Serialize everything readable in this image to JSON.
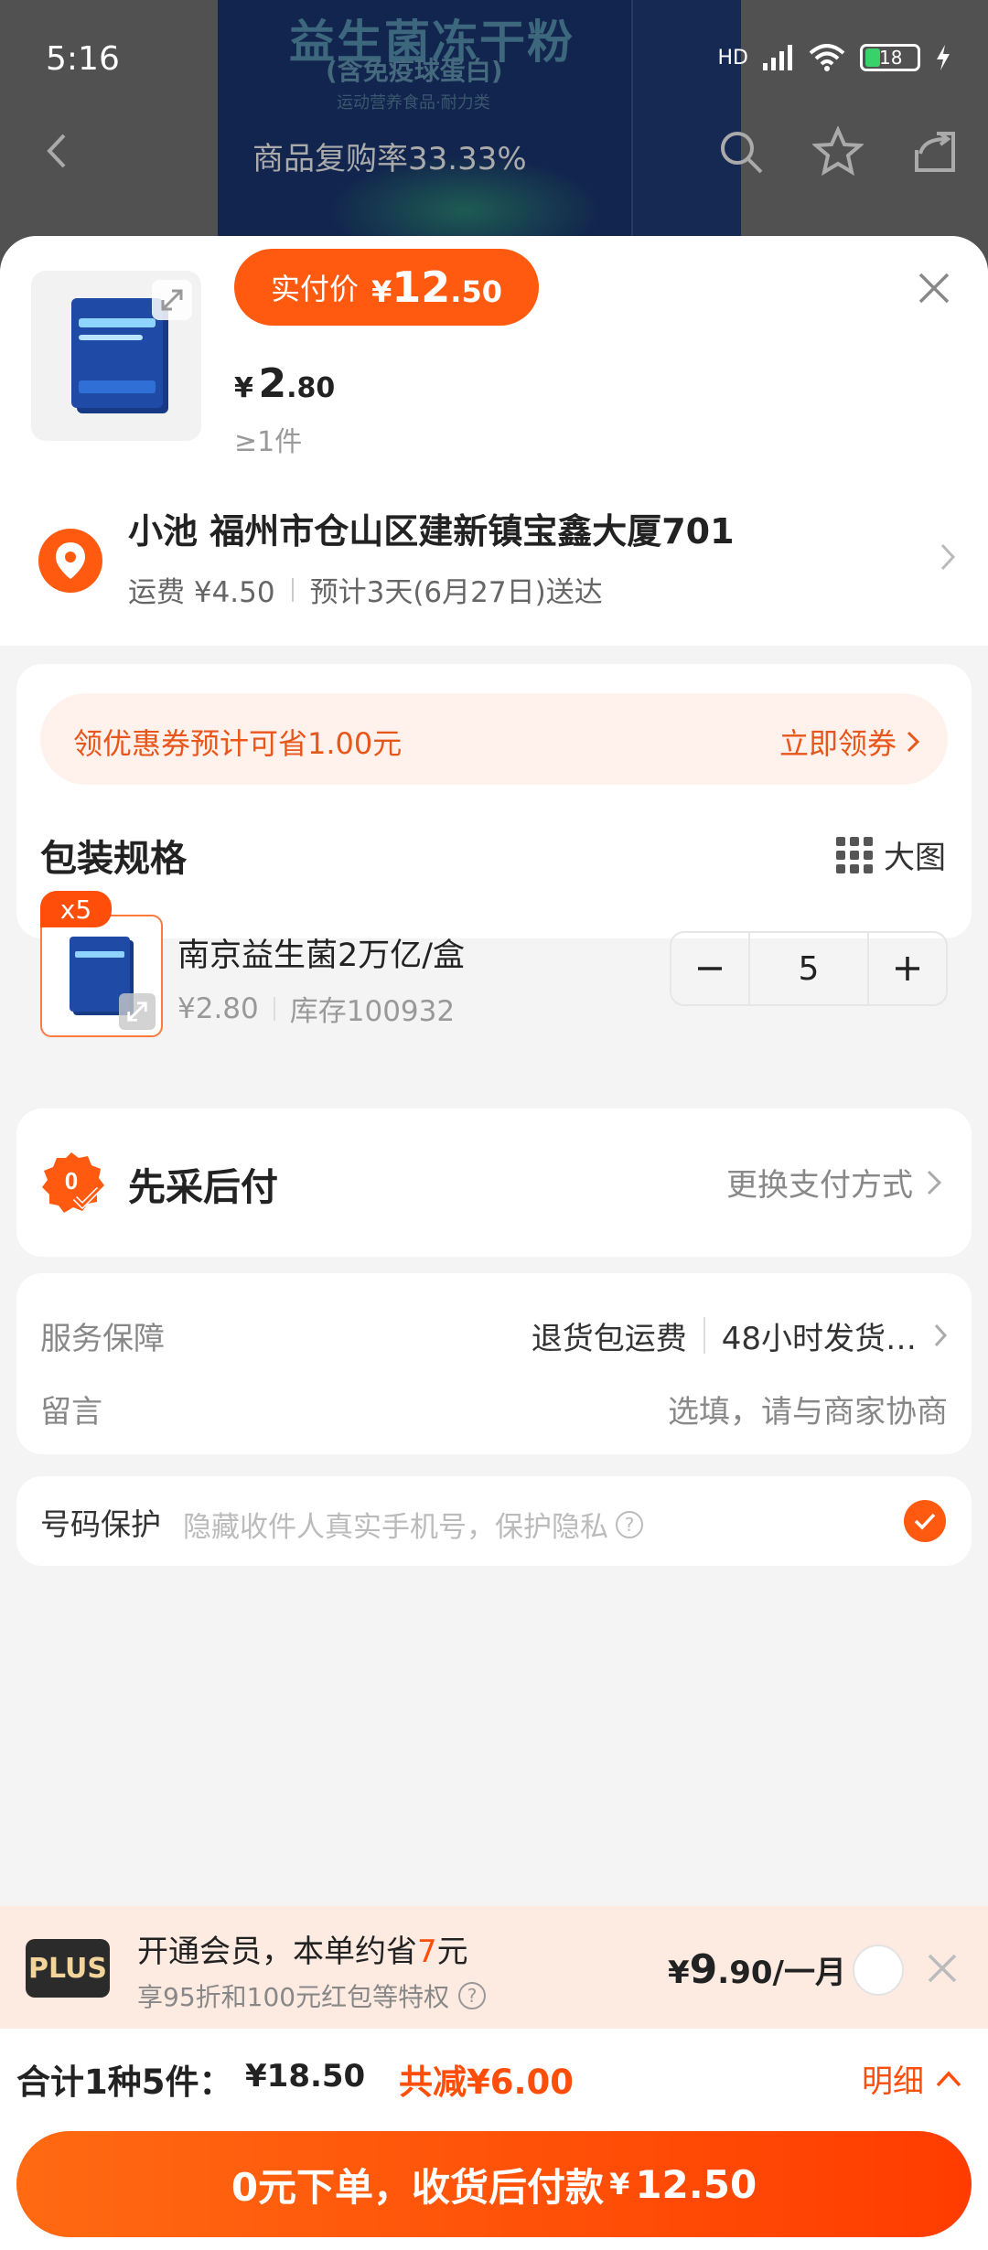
{
  "status_bar": {
    "time": "5:16",
    "battery": "18",
    "network": "HD"
  },
  "background_page": {
    "product_title": "益生菌冻干粉",
    "product_subtitle": "(含免疫球蛋白)",
    "product_caption": "运动营养食品·耐力类",
    "nav_title": "商品复购率33.33%"
  },
  "header": {
    "pay_label": "实付价",
    "pay_currency": "¥",
    "pay_int": "12",
    "pay_dec": ".50",
    "unit_currency": "¥",
    "unit_int": "2",
    "unit_dec": ".80",
    "min_qty": "≥1件"
  },
  "address": {
    "line": "小池 福州市仓山区建新镇宝鑫大厦701",
    "shipping": "运费 ¥4.50",
    "eta": "预计3天(6月27日)送达"
  },
  "coupon": {
    "text": "领优惠券预计可省1.00元",
    "link": "立即领券"
  },
  "package": {
    "title": "包装规格",
    "big_view": "大图",
    "sku": {
      "badge": "x5",
      "name": "南京益生菌2万亿/盒",
      "price": "¥2.80",
      "stock": "库存100932",
      "quantity": "5"
    }
  },
  "payment": {
    "title": "先采后付",
    "change": "更换支付方式"
  },
  "services": {
    "label": "服务保障",
    "items": [
      "退货包运费",
      "48小时发货…"
    ],
    "message_label": "留言",
    "message_placeholder": "选填，请与商家协商"
  },
  "privacy": {
    "label": "号码保护",
    "hint": "隐藏收件人真实手机号，保护隐私",
    "checked": true
  },
  "plus": {
    "logo": "PLUS",
    "title_pre": "开通会员，本单约省",
    "title_hl": "7",
    "title_post": "元",
    "subtitle": "享95折和100元红包等特权",
    "price_currency": "¥",
    "price_int": "9",
    "price_dec": ".90",
    "price_unit": "/一月"
  },
  "totals": {
    "count": "合计1种5件：",
    "amount": "¥18.50",
    "discount": "共减¥6.00",
    "detail": "明细"
  },
  "submit": {
    "label": "0元下单，收货后付款",
    "currency": "¥",
    "amount": "12.50"
  },
  "colors": {
    "accent": "#ff5a10",
    "accent_text": "#ff4d0a",
    "coupon_bg": "#fff1ec",
    "plus_bg": "#fdebe2"
  }
}
